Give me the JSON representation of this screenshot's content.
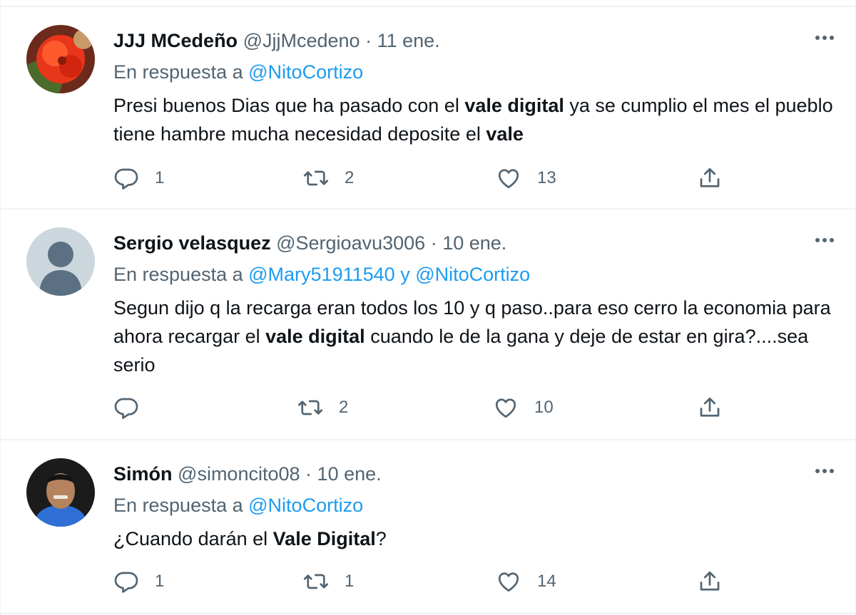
{
  "tweets": [
    {
      "name": "JJJ MCedeño",
      "handle": "@JjjMcedeno",
      "date": "11 ene.",
      "reply_prefix": "En respuesta a",
      "reply_mention1": "@NitoCortizo",
      "reply_join": "",
      "reply_mention2": "",
      "body": [
        {
          "text": "Presi buenos Dias que ha pasado con el ",
          "bold": false
        },
        {
          "text": "vale digital",
          "bold": true
        },
        {
          "text": " ya se cumplio el mes el pueblo tiene hambre mucha necesidad deposite el ",
          "bold": false
        },
        {
          "text": "vale",
          "bold": true
        }
      ],
      "counts": {
        "reply": "1",
        "retweet": "2",
        "like": "13"
      }
    },
    {
      "name": "Sergio velasquez",
      "handle": "@Sergioavu3006",
      "date": "10 ene.",
      "reply_prefix": "En respuesta a",
      "reply_mention1": "@Mary51911540",
      "reply_join": "y",
      "reply_mention2": "@NitoCortizo",
      "body": [
        {
          "text": "Segun dijo q la recarga eran todos los 10 y q paso..para eso cerro la economia para ahora recargar el ",
          "bold": false
        },
        {
          "text": "vale digital",
          "bold": true
        },
        {
          "text": " cuando le de la gana y deje de estar en gira?....sea serio",
          "bold": false
        }
      ],
      "counts": {
        "reply": "",
        "retweet": "2",
        "like": "10"
      }
    },
    {
      "name": "Simón",
      "handle": "@simoncito08",
      "date": "10 ene.",
      "reply_prefix": "En respuesta a",
      "reply_mention1": "@NitoCortizo",
      "reply_join": "",
      "reply_mention2": "",
      "body": [
        {
          "text": "¿Cuando darán el ",
          "bold": false
        },
        {
          "text": "Vale Digital",
          "bold": true
        },
        {
          "text": "?",
          "bold": false
        }
      ],
      "counts": {
        "reply": "1",
        "retweet": "1",
        "like": "14"
      }
    }
  ],
  "separator": "·",
  "colors": {
    "text": "#0f1419",
    "secondary": "#536471",
    "link": "#1d9bf0",
    "border": "#eff3f4"
  },
  "icons": {
    "more": "more-icon",
    "reply": "reply-icon",
    "retweet": "retweet-icon",
    "like": "like-icon",
    "share": "share-icon"
  }
}
